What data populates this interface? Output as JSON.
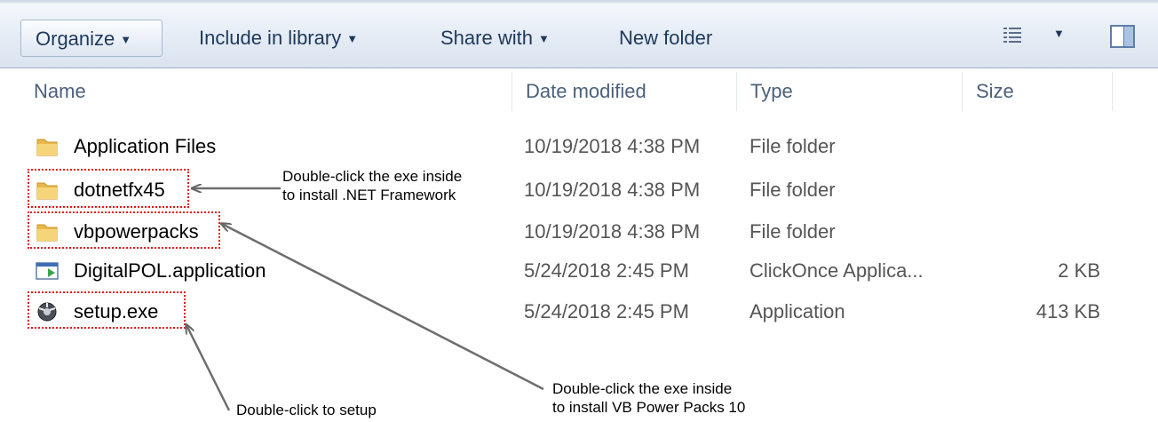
{
  "toolbar": {
    "organize": "Organize",
    "include_library": "Include in library",
    "share_with": "Share with",
    "new_folder": "New folder",
    "caret": "▼"
  },
  "columns": {
    "name": "Name",
    "date": "Date modified",
    "type": "Type",
    "size": "Size"
  },
  "files": [
    {
      "name": "Application Files",
      "date": "10/19/2018 4:38 PM",
      "type": "File folder",
      "size": "",
      "icon": "folder-icon"
    },
    {
      "name": "dotnetfx45",
      "date": "10/19/2018 4:38 PM",
      "type": "File folder",
      "size": "",
      "icon": "folder-icon"
    },
    {
      "name": "vbpowerpacks",
      "date": "10/19/2018 4:38 PM",
      "type": "File folder",
      "size": "",
      "icon": "folder-icon"
    },
    {
      "name": "DigitalPOL.application",
      "date": "5/24/2018 2:45 PM",
      "type": "ClickOnce Applica...",
      "size": "2 KB",
      "icon": "clickonce-application-icon"
    },
    {
      "name": "setup.exe",
      "date": "5/24/2018 2:45 PM",
      "type": "Application",
      "size": "413 KB",
      "icon": "setup-exe-icon"
    }
  ],
  "annotations": {
    "dotnet_line1": "Double-click the exe inside",
    "dotnet_line2": "to install .NET Framework",
    "vb_line1": "Double-click the exe inside",
    "vb_line2": "to install VB Power Packs 10",
    "setup": "Double-click to setup"
  },
  "colors": {
    "highlight": "#e31a1a",
    "folder": "#e8b84a",
    "toolbar_text": "#1e395b"
  }
}
